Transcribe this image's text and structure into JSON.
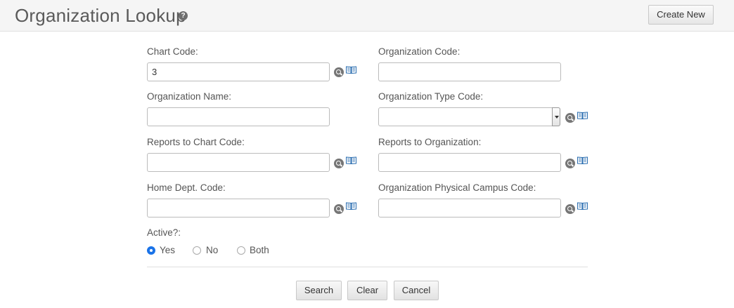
{
  "header": {
    "title": "Organization Lookup",
    "help_glyph": "?",
    "create_new_label": "Create New"
  },
  "form": {
    "chart_code": {
      "label": "Chart Code:",
      "value": "3"
    },
    "organization_code": {
      "label": "Organization Code:",
      "value": ""
    },
    "organization_name": {
      "label": "Organization Name:",
      "value": ""
    },
    "organization_type_code": {
      "label": "Organization Type Code:",
      "selected": ""
    },
    "reports_to_chart_code": {
      "label": "Reports to Chart Code:",
      "value": ""
    },
    "reports_to_organization": {
      "label": "Reports to Organization:",
      "value": ""
    },
    "home_dept_code": {
      "label": "Home Dept. Code:",
      "value": ""
    },
    "organization_physical_campus_code": {
      "label": "Organization Physical Campus Code:",
      "value": ""
    },
    "active": {
      "label": "Active?:",
      "options": [
        "Yes",
        "No",
        "Both"
      ],
      "selected": "Yes"
    }
  },
  "actions": {
    "search_label": "Search",
    "clear_label": "Clear",
    "cancel_label": "Cancel"
  },
  "icons": {
    "lookup": "search-lookup-icon",
    "inquiry": "book-inquiry-icon"
  },
  "colors": {
    "accent": "#1a73e8",
    "header_bg": "#f5f5f5"
  }
}
